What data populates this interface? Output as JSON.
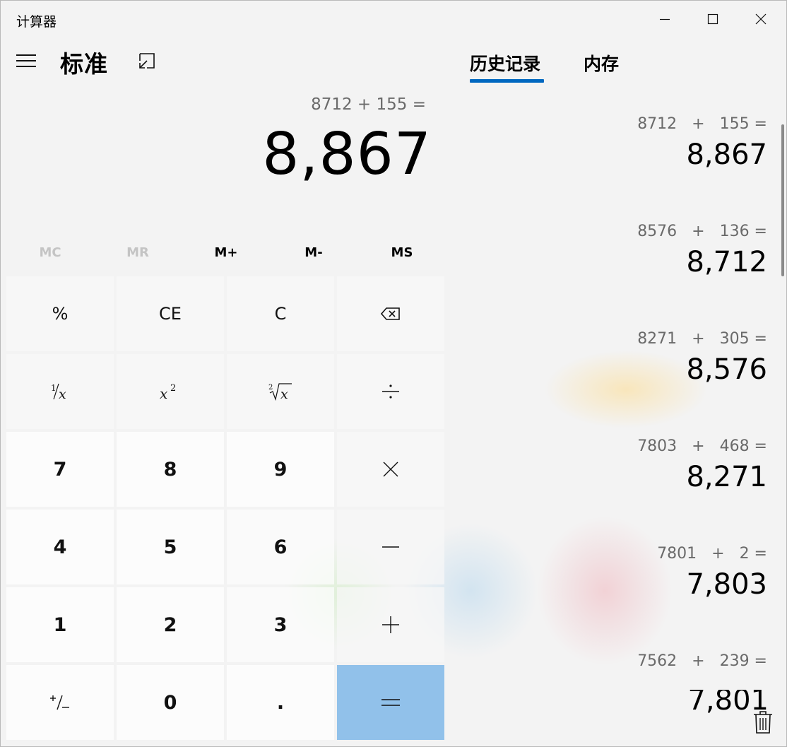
{
  "app": {
    "title": "计算器"
  },
  "header": {
    "mode_title": "标准"
  },
  "display": {
    "expression": "8712 + 155 =",
    "result": "8,867"
  },
  "memory_row": [
    {
      "label": "MC",
      "enabled": false
    },
    {
      "label": "MR",
      "enabled": false
    },
    {
      "label": "M+",
      "enabled": true
    },
    {
      "label": "M-",
      "enabled": true
    },
    {
      "label": "MS",
      "enabled": true
    }
  ],
  "keys": {
    "percent": "%",
    "ce": "CE",
    "c": "C",
    "seven": "7",
    "eight": "8",
    "nine": "9",
    "four": "4",
    "five": "5",
    "six": "6",
    "one": "1",
    "two": "2",
    "three": "3",
    "zero": "0",
    "decimal": "."
  },
  "panel": {
    "tabs": [
      {
        "label": "历史记录",
        "active": true
      },
      {
        "label": "内存",
        "active": false
      }
    ],
    "history": [
      {
        "expression": "8712   +   155 =",
        "result": "8,867"
      },
      {
        "expression": "8576   +   136 =",
        "result": "8,712"
      },
      {
        "expression": "8271   +   305 =",
        "result": "8,576"
      },
      {
        "expression": "7803   +   468 =",
        "result": "8,271"
      },
      {
        "expression": "7801   +   2 =",
        "result": "7,803"
      },
      {
        "expression": "7562   +   239 =",
        "result": "7,801"
      }
    ]
  },
  "colors": {
    "equals_key": "#91c1ea",
    "tab_accent": "#0067c0"
  }
}
